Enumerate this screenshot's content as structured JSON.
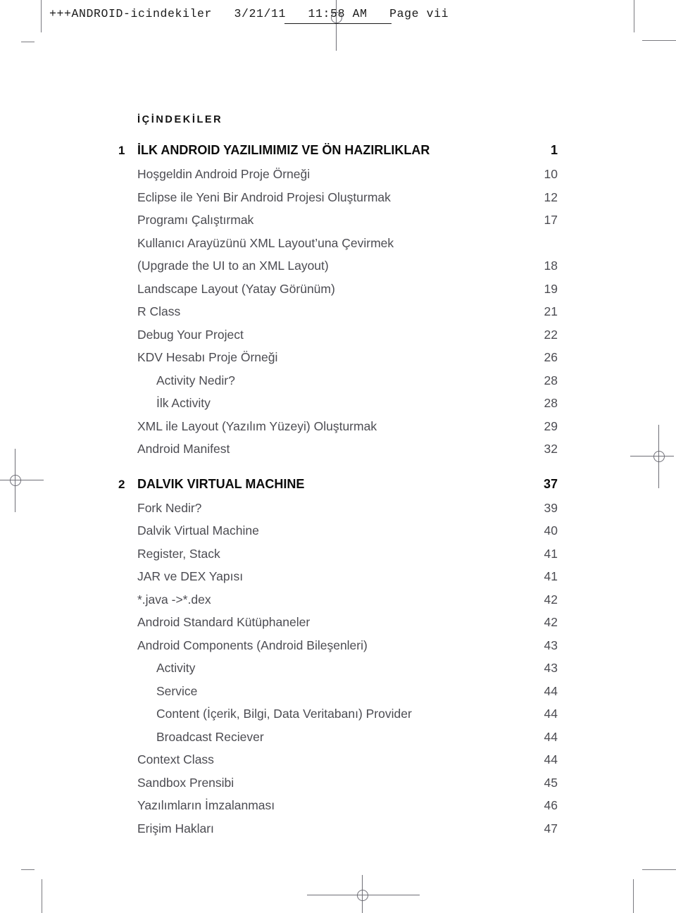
{
  "slug": {
    "text": "+++ANDROID-icindekiler   3/21/11   11:58 AM   Page vii"
  },
  "toc": {
    "heading": "İÇİNDEKİLER",
    "entries": [
      {
        "kind": "chapter",
        "number": "1",
        "label": "İLK ANDROID YAZILIMIMIZ VE ÖN HAZIRLIKLAR",
        "page": "1",
        "level": 0
      },
      {
        "kind": "entry",
        "number": "",
        "label": "Hoşgeldin Android Proje Örneği",
        "page": "10",
        "level": 0
      },
      {
        "kind": "entry",
        "number": "",
        "label": "Eclipse ile Yeni Bir Android Projesi Oluşturmak",
        "page": "12",
        "level": 0
      },
      {
        "kind": "entry",
        "number": "",
        "label": "Programı Çalıştırmak",
        "page": "17",
        "level": 0
      },
      {
        "kind": "entry",
        "number": "",
        "label": "Kullanıcı Arayüzünü XML Layout’una Çevirmek",
        "page": "",
        "level": 0
      },
      {
        "kind": "entry",
        "number": "",
        "label": "(Upgrade the UI to an XML Layout)",
        "page": "18",
        "level": 0
      },
      {
        "kind": "entry",
        "number": "",
        "label": "Landscape Layout (Yatay Görünüm)",
        "page": "19",
        "level": 0
      },
      {
        "kind": "entry",
        "number": "",
        "label": "R Class",
        "page": "21",
        "level": 0
      },
      {
        "kind": "entry",
        "number": "",
        "label": "Debug Your Project",
        "page": "22",
        "level": 0
      },
      {
        "kind": "entry",
        "number": "",
        "label": "KDV Hesabı Proje Örneği",
        "page": "26",
        "level": 0
      },
      {
        "kind": "entry",
        "number": "",
        "label": "Activity Nedir?",
        "page": "28",
        "level": 1
      },
      {
        "kind": "entry",
        "number": "",
        "label": "İlk Activity",
        "page": "28",
        "level": 1
      },
      {
        "kind": "entry",
        "number": "",
        "label": "XML ile Layout (Yazılım Yüzeyi) Oluşturmak",
        "page": "29",
        "level": 0
      },
      {
        "kind": "entry",
        "number": "",
        "label": "Android Manifest",
        "page": "32",
        "level": 0
      },
      {
        "kind": "chapter",
        "number": "2",
        "label": "DALVIK VIRTUAL MACHINE",
        "page": "37",
        "level": 0
      },
      {
        "kind": "entry",
        "number": "",
        "label": "Fork Nedir?",
        "page": "39",
        "level": 0
      },
      {
        "kind": "entry",
        "number": "",
        "label": "Dalvik Virtual Machine",
        "page": "40",
        "level": 0
      },
      {
        "kind": "entry",
        "number": "",
        "label": "Register, Stack",
        "page": "41",
        "level": 0
      },
      {
        "kind": "entry",
        "number": "",
        "label": "JAR ve DEX Yapısı",
        "page": "41",
        "level": 0
      },
      {
        "kind": "entry",
        "number": "",
        "label": "*.java ->*.dex",
        "page": "42",
        "level": 0
      },
      {
        "kind": "entry",
        "number": "",
        "label": "Android Standard Kütüphaneler",
        "page": "42",
        "level": 0
      },
      {
        "kind": "entry",
        "number": "",
        "label": "Android Components (Android Bileşenleri)",
        "page": "43",
        "level": 0
      },
      {
        "kind": "entry",
        "number": "",
        "label": "Activity",
        "page": "43",
        "level": 1
      },
      {
        "kind": "entry",
        "number": "",
        "label": "Service",
        "page": "44",
        "level": 1
      },
      {
        "kind": "entry",
        "number": "",
        "label": "Content (İçerik, Bilgi, Data Veritabanı) Provider",
        "page": "44",
        "level": 1
      },
      {
        "kind": "entry",
        "number": "",
        "label": "Broadcast Reciever",
        "page": "44",
        "level": 1
      },
      {
        "kind": "entry",
        "number": "",
        "label": "Context Class",
        "page": "44",
        "level": 0
      },
      {
        "kind": "entry",
        "number": "",
        "label": "Sandbox Prensibi",
        "page": "45",
        "level": 0
      },
      {
        "kind": "entry",
        "number": "",
        "label": "Yazılımların İmzalanması",
        "page": "46",
        "level": 0
      },
      {
        "kind": "entry",
        "number": "",
        "label": "Erişim Hakları",
        "page": "47",
        "level": 0
      }
    ]
  },
  "marks": {
    "registration_label": "registration-target",
    "crop_label": "crop-mark"
  }
}
